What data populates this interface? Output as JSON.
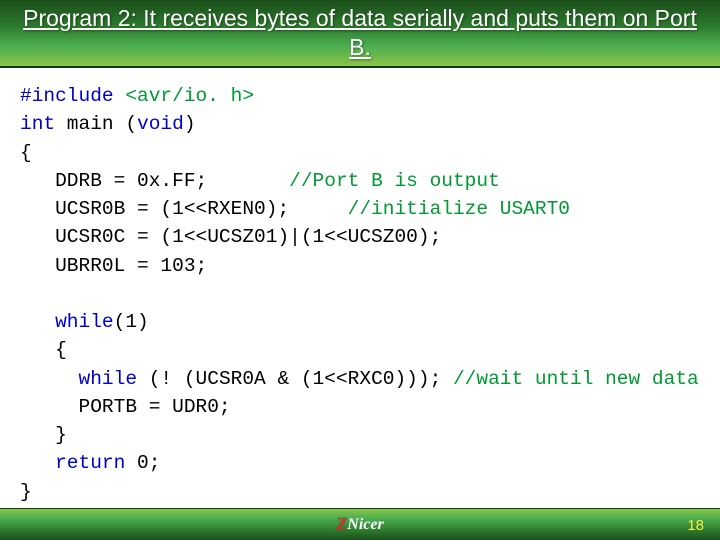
{
  "header": {
    "title": "Program 2: It receives bytes of data serially and puts them on Port B."
  },
  "code": {
    "l1a": "#include ",
    "l1b": "<avr/io. h>",
    "l2a": "int",
    "l2b": " main (",
    "l2c": "void",
    "l2d": ")",
    "l3": "{",
    "l4a": "   DDRB = 0x.FF;       ",
    "l4b": "//Port B is output",
    "l5a": "   UCSR0B = (1<<RXEN0);     ",
    "l5b": "//initialize USART0",
    "l6": "   UCSR0C = (1<<UCSZ01)|(1<<UCSZ00);",
    "l7": "   UBRR0L = 103;",
    "l8": "",
    "l9a": "   ",
    "l9b": "while",
    "l9c": "(1)",
    "l10": "   {",
    "l11a": "     ",
    "l11b": "while",
    "l11c": " (! (UCSR0A & (1<<RXC0))); ",
    "l11d": "//wait until new data",
    "l12": "     PORTB = UDR0;",
    "l13": "   }",
    "l14a": "   ",
    "l14b": "return",
    "l14c": " 0;",
    "l15": "}"
  },
  "footer": {
    "logo_z": "Z",
    "logo_text": "Nicer",
    "page_number": "18"
  }
}
